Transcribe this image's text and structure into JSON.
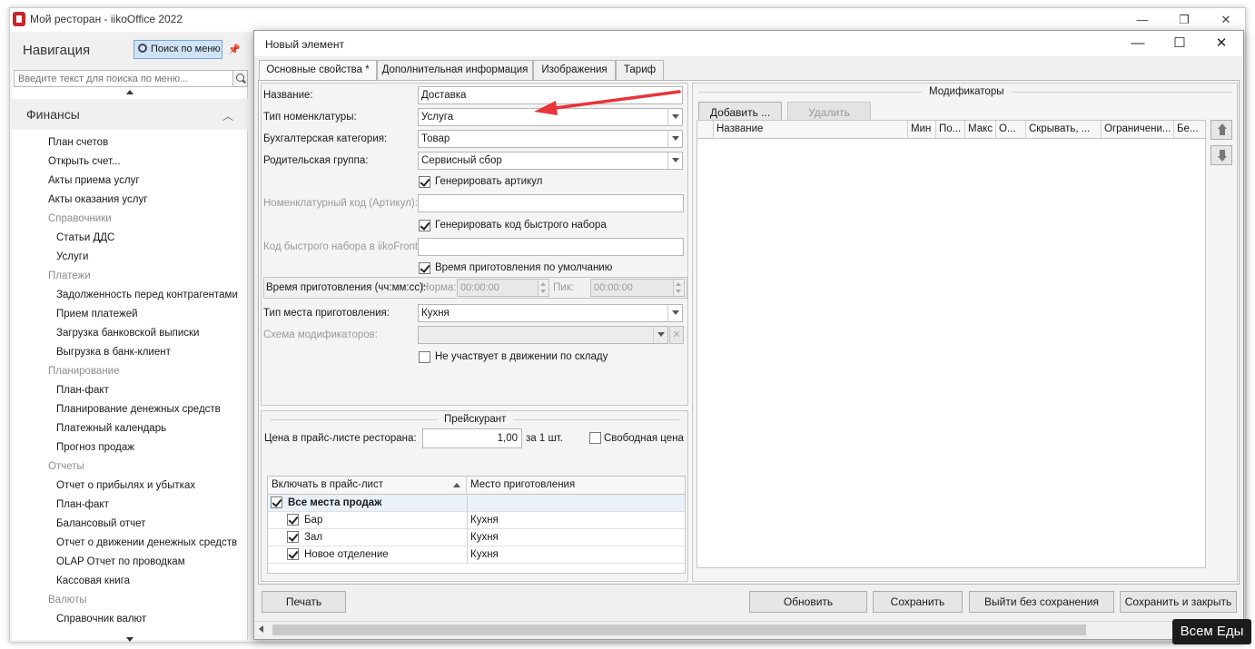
{
  "app": {
    "title": "Мой ресторан - iikoOffice 2022",
    "minimize": "—",
    "restore": "❐",
    "close": "✕"
  },
  "nav": {
    "title": "Навигация",
    "menu_search_label": "Поиск по меню",
    "search_placeholder": "Введите текст для поиска по меню...",
    "section_title": "Финансы",
    "items": [
      {
        "label": "План счетов",
        "kind": "lvl1"
      },
      {
        "label": "Открыть счет...",
        "kind": "lvl1"
      },
      {
        "label": "Акты приема услуг",
        "kind": "lvl1"
      },
      {
        "label": "Акты оказания услуг",
        "kind": "lvl1"
      },
      {
        "label": "Справочники",
        "kind": "grp"
      },
      {
        "label": "Статьи ДДС",
        "kind": "lvl2"
      },
      {
        "label": "Услуги",
        "kind": "lvl2"
      },
      {
        "label": "Платежи",
        "kind": "grp"
      },
      {
        "label": "Задолженность перед контрагентами",
        "kind": "lvl2"
      },
      {
        "label": "Прием платежей",
        "kind": "lvl2"
      },
      {
        "label": "Загрузка банковской выписки",
        "kind": "lvl2"
      },
      {
        "label": "Выгрузка в банк-клиент",
        "kind": "lvl2"
      },
      {
        "label": "Планирование",
        "kind": "grp"
      },
      {
        "label": "План-факт",
        "kind": "lvl2"
      },
      {
        "label": "Планирование денежных средств",
        "kind": "lvl2"
      },
      {
        "label": "Платежный календарь",
        "kind": "lvl2"
      },
      {
        "label": "Прогноз продаж",
        "kind": "lvl2"
      },
      {
        "label": "Отчеты",
        "kind": "grp"
      },
      {
        "label": "Отчет о прибылях и убытках",
        "kind": "lvl2"
      },
      {
        "label": "План-факт",
        "kind": "lvl2"
      },
      {
        "label": "Балансовый отчет",
        "kind": "lvl2"
      },
      {
        "label": "Отчет о движении денежных средств",
        "kind": "lvl2"
      },
      {
        "label": "OLAP Отчет по проводкам",
        "kind": "lvl2"
      },
      {
        "label": "Кассовая книга",
        "kind": "lvl2"
      },
      {
        "label": "Валюты",
        "kind": "grp"
      },
      {
        "label": "Справочник валют",
        "kind": "lvl2"
      }
    ]
  },
  "dialog": {
    "title": "Новый элемент",
    "tabs": [
      "Основные свойства *",
      "Дополнительная информация",
      "Изображения",
      "Тариф"
    ],
    "form": {
      "name_label": "Название:",
      "name_value": "Доставка",
      "type_label": "Тип номенклатуры:",
      "type_value": "Услуга",
      "category_label": "Бухгалтерская категория:",
      "category_value": "Товар",
      "parent_label": "Родительская группа:",
      "parent_value": "Сервисный сбор",
      "gen_article_label": "Генерировать артикул",
      "article_label": "Номенклатурный код (Артикул):",
      "gen_quick_label": "Генерировать код быстрого набора",
      "quick_label": "Код быстрого набора в iikoFront:",
      "default_time_label": "Время приготовления по умолчанию",
      "time_label": "Время приготовления (чч:мм:сс):",
      "norm_label": "Норма:",
      "norm_value": "00:00:00",
      "peak_label": "Пик:",
      "peak_value": "00:00:00",
      "place_type_label": "Тип места приготовления:",
      "place_type_value": "Кухня",
      "mod_scheme_label": "Схема модификаторов:",
      "not_in_stock_label": "Не участвует в движении по складу"
    },
    "price": {
      "legend": "Прейскурант",
      "price_label": "Цена в прайс-листе ресторана:",
      "price_value": "1,00",
      "per_unit": "за 1 шт.",
      "free_price_label": "Свободная цена",
      "col_include": "Включать в прайс-лист",
      "col_place": "Место приготовления",
      "rows": [
        {
          "name": "Все места продаж",
          "place": "",
          "bold": true
        },
        {
          "name": "Бар",
          "place": "Кухня",
          "bold": false
        },
        {
          "name": "Зал",
          "place": "Кухня",
          "bold": false
        },
        {
          "name": "Новое отделение",
          "place": "Кухня",
          "bold": false
        }
      ]
    },
    "modifiers": {
      "legend": "Модификаторы",
      "add_label": "Добавить ...",
      "delete_label": "Удалить",
      "columns": [
        "Название",
        "Мин",
        "По...",
        "Макс",
        "О...",
        "Скрывать, ...",
        "Ограничени...",
        "Бе..."
      ]
    },
    "buttons": {
      "print": "Печать",
      "refresh": "Обновить",
      "save": "Сохранить",
      "exit_no_save": "Выйти без сохранения",
      "save_close": "Сохранить и закрыть"
    }
  },
  "watermark": "Всем Еды",
  "colors": {
    "annotation_arrow": "#e8343a",
    "selection_blue": "#cfe3f6",
    "brand_red": "#c8252c"
  }
}
